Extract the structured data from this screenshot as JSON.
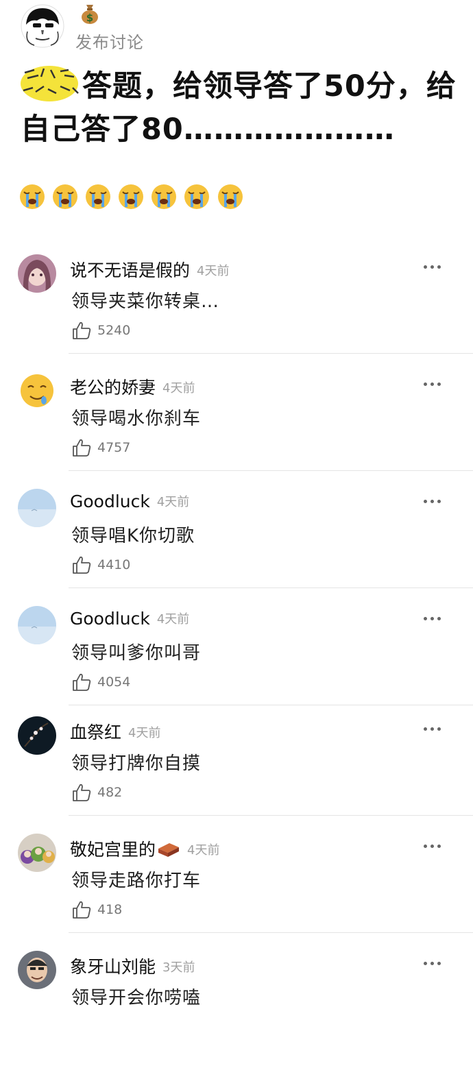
{
  "post": {
    "action": "发布讨论",
    "sticker_icon": "meme-sticker",
    "title_rest": "答题，给领导答了50分，给自己答了80…………………",
    "emoji_icon": "loudly-crying-face",
    "emoji_count": 7
  },
  "comments": [
    {
      "author": "说不无语是假的",
      "time": "4天前",
      "text": "领导夹菜你转桌…",
      "likes": "5240",
      "avatar": "anime-girl"
    },
    {
      "author": "老公的娇妻",
      "time": "4天前",
      "text": "领导喝水你刹车",
      "likes": "4757",
      "avatar": "drooling-emoji"
    },
    {
      "author": "Goodluck",
      "time": "4天前",
      "text": "领导唱K你切歌",
      "likes": "4410",
      "avatar": "sky-photo"
    },
    {
      "author": "Goodluck",
      "time": "4天前",
      "text": "领导叫爹你叫哥",
      "likes": "4054",
      "avatar": "sky-photo"
    },
    {
      "author": "血祭红",
      "time": "4天前",
      "text": "领导打牌你自摸",
      "likes": "482",
      "avatar": "dark-flower-photo"
    },
    {
      "author": "敬妃宫里的",
      "time": "4天前",
      "text": "领导走路你打车",
      "likes": "418",
      "avatar": "teletubbies",
      "badge": "brick-icon"
    },
    {
      "author": "象牙山刘能",
      "time": "3天前",
      "text": "领导开会你唠嗑",
      "likes": "",
      "avatar": "man-photo"
    }
  ]
}
